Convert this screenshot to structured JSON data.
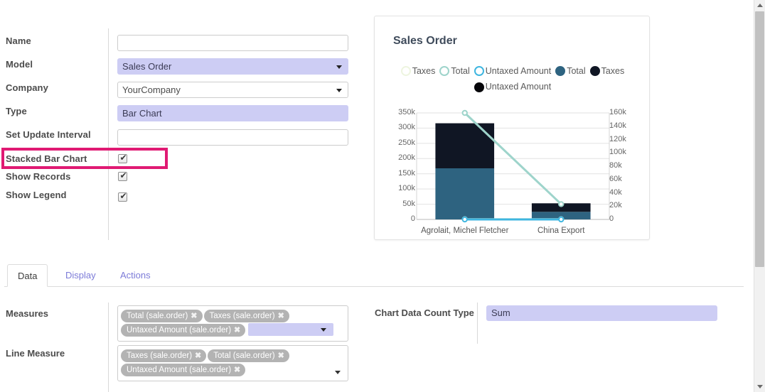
{
  "form": {
    "fields": [
      {
        "label": "Name",
        "value": "",
        "type": "text",
        "required": false
      },
      {
        "label": "Model",
        "value": "Sales Order",
        "type": "select",
        "required": true
      },
      {
        "label": "Company",
        "value": "YourCompany",
        "type": "select",
        "required": false
      },
      {
        "label": "Type",
        "value": "Bar Chart",
        "type": "select",
        "required": true
      },
      {
        "label": "Set Update Interval",
        "value": "",
        "type": "text",
        "required": false
      }
    ],
    "checkboxes": [
      {
        "label": "Stacked Bar Chart",
        "checked": true,
        "highlighted": true
      },
      {
        "label": "Show Records",
        "checked": true,
        "highlighted": false
      },
      {
        "label": "Show Legend",
        "checked": true,
        "highlighted": false
      }
    ],
    "highlight_color": "#e01a73",
    "required_field_color": "#cdcdf4"
  },
  "tabs": {
    "items": [
      {
        "label": "Data",
        "active": true
      },
      {
        "label": "Display",
        "active": false
      },
      {
        "label": "Actions",
        "active": false
      }
    ]
  },
  "data_section": {
    "measures": {
      "label": "Measures",
      "tags": [
        "Total (sale.order)",
        "Taxes (sale.order)",
        "Untaxed Amount (sale.order)"
      ],
      "remove_glyph": "✖",
      "input_value": ""
    },
    "line_measure": {
      "label": "Line Measure",
      "tags": [
        "Taxes (sale.order)",
        "Total (sale.order)",
        "Untaxed Amount (sale.order)"
      ],
      "remove_glyph": "✖"
    },
    "count_type": {
      "label": "Chart Data Count Type",
      "value": "Sum"
    }
  },
  "scrollbar": {
    "up_glyph": "▲",
    "down_glyph": "▼"
  },
  "chart_data": {
    "type": "bar",
    "title": "Sales Order",
    "categories": [
      "Agrolait, Michel Fletcher",
      "China Export"
    ],
    "stacked": true,
    "xlabel": "",
    "ylabel": "",
    "ylim": [
      0,
      350000
    ],
    "y2lim": [
      0,
      160000
    ],
    "yticks": [
      "0",
      "50k",
      "100k",
      "150k",
      "200k",
      "250k",
      "300k",
      "350k"
    ],
    "ytick_values": [
      0,
      50000,
      100000,
      150000,
      200000,
      250000,
      300000,
      350000
    ],
    "y2ticks": [
      "0",
      "20k",
      "40k",
      "60k",
      "80k",
      "100k",
      "120k",
      "140k",
      "160k"
    ],
    "y2tick_values": [
      0,
      20000,
      40000,
      60000,
      80000,
      100000,
      120000,
      140000,
      160000
    ],
    "grid": true,
    "legend_position": "top",
    "legend": [
      {
        "label": "Taxes",
        "color": "#eef5e0",
        "style": "ring"
      },
      {
        "label": "Total",
        "color": "#9ed4cb",
        "style": "ring"
      },
      {
        "label": "Untaxed Amount",
        "color": "#3fb6e0",
        "style": "ring"
      },
      {
        "label": "Total",
        "color": "#2e6380",
        "style": "filled"
      },
      {
        "label": "Taxes",
        "color": "#101624",
        "style": "filled"
      },
      {
        "label": "Untaxed Amount",
        "color": "#06060a",
        "style": "filled"
      }
    ],
    "bar_series": [
      {
        "name": "Total",
        "color": "#2e6380",
        "values": [
          168000,
          25000
        ]
      },
      {
        "name": "Taxes",
        "color": "#101624",
        "values": [
          148000,
          28000
        ]
      },
      {
        "name": "Untaxed Amount",
        "color": "#06060a",
        "values": [
          0,
          0
        ]
      }
    ],
    "line_series": [
      {
        "name": "Total",
        "color": "#9ed4cb",
        "axis": "right",
        "values": [
          160000,
          23000
        ]
      },
      {
        "name": "Taxes",
        "color": "#e6f2d8",
        "axis": "right",
        "values": [
          300,
          300
        ]
      },
      {
        "name": "Untaxed Amount",
        "color": "#3fb6e0",
        "axis": "right",
        "values": [
          0,
          0
        ]
      }
    ]
  }
}
